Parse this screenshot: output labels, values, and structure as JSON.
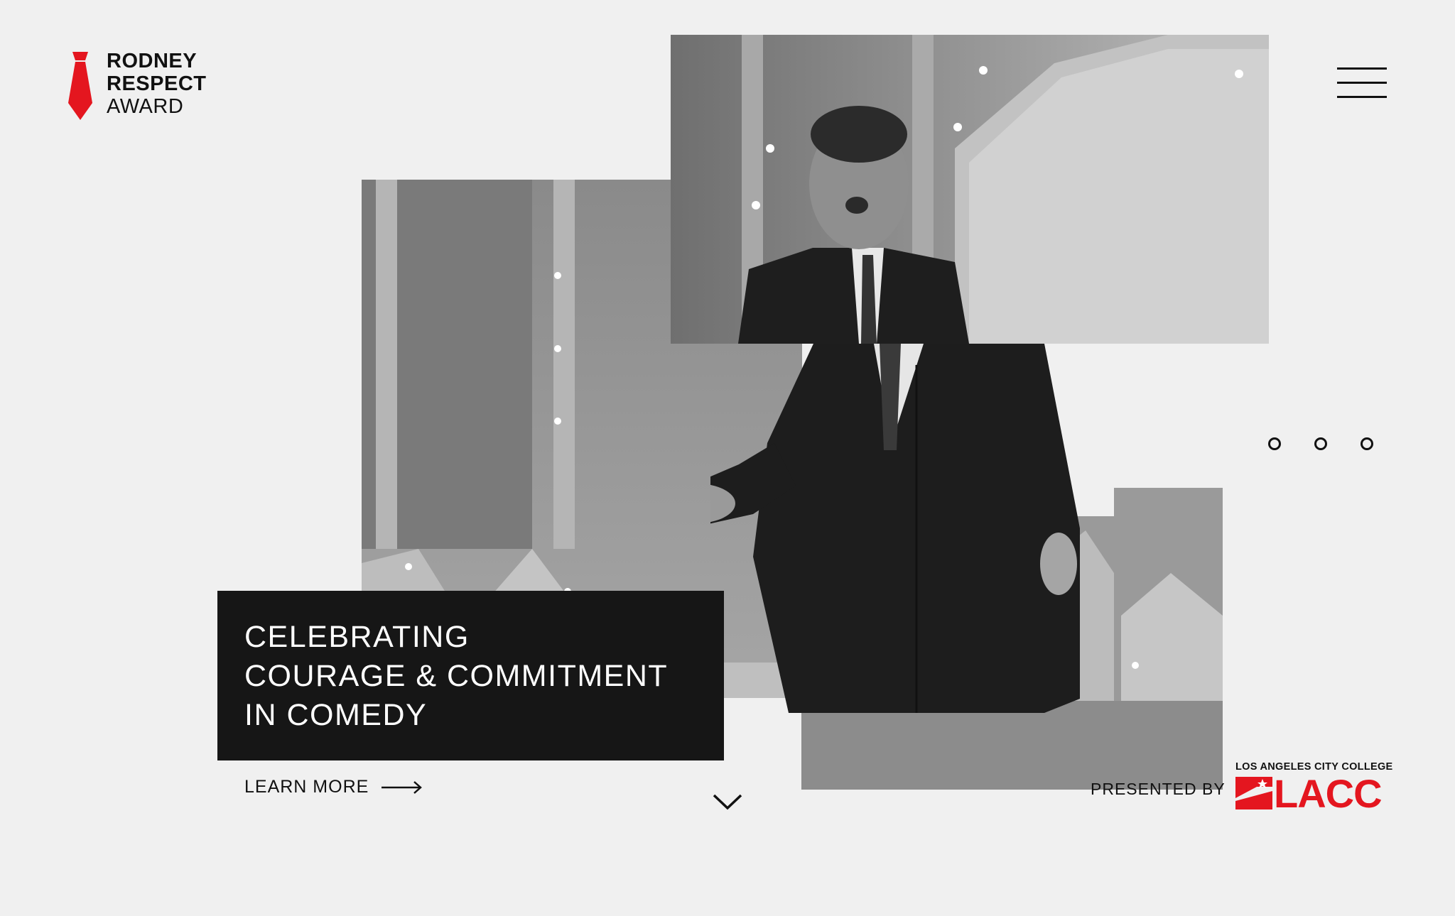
{
  "brand": {
    "line1": "RODNEY",
    "line2": "RESPECT",
    "line3": "AWARD",
    "accent_color": "#e4161f",
    "logo_icon": "red-necktie-icon"
  },
  "menu": {
    "icon": "hamburger-menu-icon"
  },
  "slider": {
    "dot_count": 3
  },
  "hero": {
    "headline_line1": "CELEBRATING",
    "headline_line2": "COURAGE & COMMITMENT",
    "headline_line3": "IN COMEDY",
    "photo_subject": "black-and-white photo of comedian in suit on stage"
  },
  "cta": {
    "learn_more": "LEARN MORE",
    "arrow_icon": "arrow-right-icon"
  },
  "scroll": {
    "icon": "chevron-down-icon"
  },
  "sponsor": {
    "presented_by": "PRESENTED BY",
    "tagline": "LOS ANGELES CITY COLLEGE",
    "name": "LACC",
    "color": "#e4161f"
  }
}
